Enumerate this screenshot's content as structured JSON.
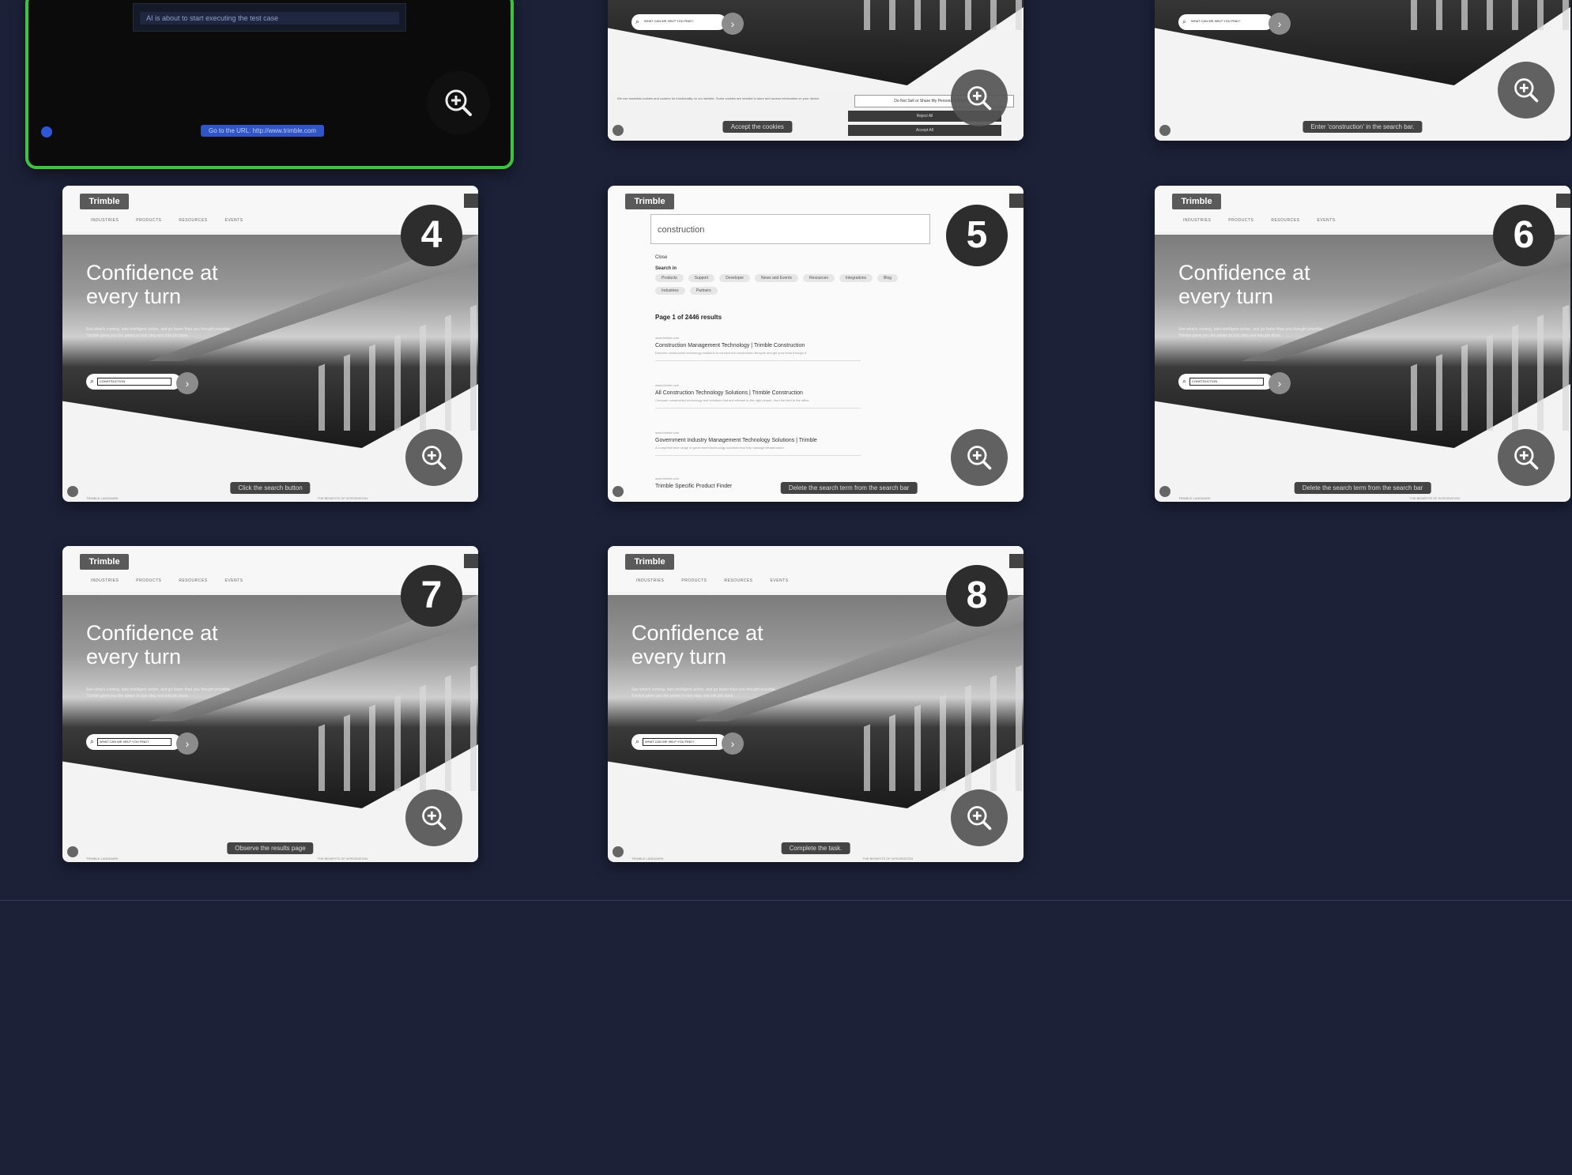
{
  "active_card": {
    "log_line": "AI is about to start executing the test case",
    "url_label": "Go to the URL: http://www.trimble.com"
  },
  "site": {
    "logo": "Trimble",
    "nav": [
      "INDUSTRIES",
      "PRODUCTS",
      "RESOURCES",
      "EVENTS"
    ],
    "top_icons": [
      "search-icon",
      "user-icon",
      "menu-icon"
    ],
    "hero_heading": "Confidence at every turn",
    "hero_sub": "See what's coming, take intelligent action, and go faster than you thought possible. Trimble gives you the power to turn step one into job done.",
    "footer_left": "TRIMBLE LANDMARK",
    "footer_right": "THE BENEFITS OF INTEGRATION"
  },
  "cookie": {
    "text": "We use essential cookies and cookies for functionality on our website. Some cookies are needed to store and access information on your device.",
    "do_not_sell": "Do Not Sell or Share My Personal Information",
    "reject": "Reject All",
    "accept": "Accept All",
    "accept_caption": "Accept the cookies"
  },
  "cards": [
    {
      "id": "card-2",
      "number": "",
      "search_text": "WHAT CAN WE HELP YOU FIND?",
      "caption": "Accept the cookies"
    },
    {
      "id": "card-3",
      "number": "",
      "search_text": "WHAT CAN WE HELP YOU FIND?",
      "caption": "Enter 'construction' in the search bar."
    },
    {
      "id": "card-4",
      "number": "4",
      "search_text": "CONSTRUCTION",
      "caption": "Click the search button"
    },
    {
      "id": "card-5",
      "number": "5",
      "caption": "Delete the search term from the search bar"
    },
    {
      "id": "card-6",
      "number": "6",
      "search_text": "CONSTRUCTION",
      "caption": "Delete the search term from the search bar"
    },
    {
      "id": "card-7",
      "number": "7",
      "search_text": "WHAT CAN WE HELP YOU FIND?",
      "caption": "Observe the results page"
    },
    {
      "id": "card-8",
      "number": "8",
      "search_text": "WHAT CAN WE HELP YOU FIND?",
      "caption": "Complete the task."
    }
  ],
  "results": {
    "query": "construction",
    "label_small": "Close",
    "search_in": "Search in",
    "chips": [
      "Products",
      "Support",
      "Developer",
      "News and Events",
      "Resources",
      "Integrations",
      "Blog",
      "Industries",
      "Partners"
    ],
    "page_info": "Page 1 of 2446 results",
    "items": [
      {
        "url": "www.trimble.com",
        "title": "Construction Management Technology | Trimble Construction",
        "desc": "Discover construction technology solutions to connect the construction lifecycle and get your team through it."
      },
      {
        "url": "www.trimble.com",
        "title": "All Construction Technology Solutions | Trimble Construction",
        "desc": "Compare construction technology and solutions that are relevant to the right people, from the field to the office."
      },
      {
        "url": "www.trimble.com",
        "title": "Government Industry Management Technology Solutions | Trimble",
        "desc": "A comprehensive range of government technology solutions that help manage infrastructure."
      },
      {
        "url": "www.trimble.com",
        "title": "Trimble Specific Product Finder",
        "desc": ""
      }
    ]
  }
}
